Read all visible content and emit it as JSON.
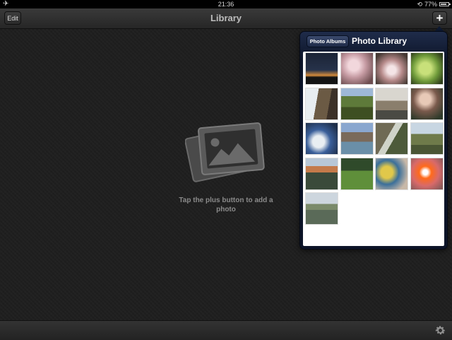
{
  "status_bar": {
    "time": "21:36",
    "battery": "77%"
  },
  "navbar": {
    "title": "Library",
    "edit_label": "Edit",
    "add_label": "+"
  },
  "empty_state": {
    "message": "Tap the plus button to add a photo"
  },
  "popover": {
    "back_label": "Photo Albums",
    "title": "Photo Library",
    "photos": [
      {
        "id": 1,
        "bg": "linear-gradient(#1c2436 0%, #26324a 55%, #d48a3b 72%, #141414 78%)"
      },
      {
        "id": 2,
        "bg": "radial-gradient(circle at 40% 40%, #f2d7dc 0 20%, #c59aa2 45%, #6d4d4f 85%)"
      },
      {
        "id": 3,
        "bg": "radial-gradient(circle at 50% 55%, #f4e4e6 0 18%, #b68a8a 45%, #463a34 85%)"
      },
      {
        "id": 4,
        "bg": "radial-gradient(circle at 45% 50%, #c8e07a 0 25%, #6f9a3a 55%, #2e3d1b 90%)"
      },
      {
        "id": 5,
        "bg": "linear-gradient(100deg, #e8edf0 0 35%, #6b5a44 35% 70%, #3c3128 70%)"
      },
      {
        "id": 6,
        "bg": "linear-gradient(#9eb8d6 0 25%, #5e7a3a 25% 60%, #3e4f22 60%)"
      },
      {
        "id": 7,
        "bg": "linear-gradient(#d9d6cf 0 40%, #8a7e6c 40% 70%, #4a4a44 70%)"
      },
      {
        "id": 8,
        "bg": "radial-gradient(circle at 45% 35%, #e8c9b7 0 20%, #7a5a4c 45%, #2f3a2a 85%)"
      },
      {
        "id": 9,
        "bg": "radial-gradient(circle at 40% 60%, #e9eef2 0 22%, #3a5f9a 45%, #1f2f4a 85%)"
      },
      {
        "id": 10,
        "bg": "linear-gradient(#8aa7cf 0 30%, #7a6a5a 30% 60%, #6a8fa8 60%)"
      },
      {
        "id": 11,
        "bg": "linear-gradient(120deg, #6f6a55 0 40%, #cfd3c9 40% 55%, #4d5a3a 55%)"
      },
      {
        "id": 12,
        "bg": "linear-gradient(#c8d6e2 0 35%, #6f7a4a 35% 70%, #4a5534 70%)"
      },
      {
        "id": 13,
        "bg": "linear-gradient(#b8c7d6 0 25%, #c47a4a 25% 45%, #3a4a3a 45%)"
      },
      {
        "id": 14,
        "bg": "linear-gradient(#2f4a2a 0 40%, #5f8f3a 40%)"
      },
      {
        "id": 15,
        "bg": "radial-gradient(circle at 35% 45%, #e0c84a 0 22%, #3a6f9a 45%, #c8b8a8 80%)"
      },
      {
        "id": 16,
        "bg": "radial-gradient(circle at 45% 45%, #ffffff 0 10%, #ff6a1a 25%, #d86a6a 55%, #8a5a5a 90%)"
      },
      {
        "id": 17,
        "bg": "linear-gradient(#cdd6de 0 35%, #7a8a6a 35% 55%, #5a6a58 55%)"
      }
    ]
  }
}
